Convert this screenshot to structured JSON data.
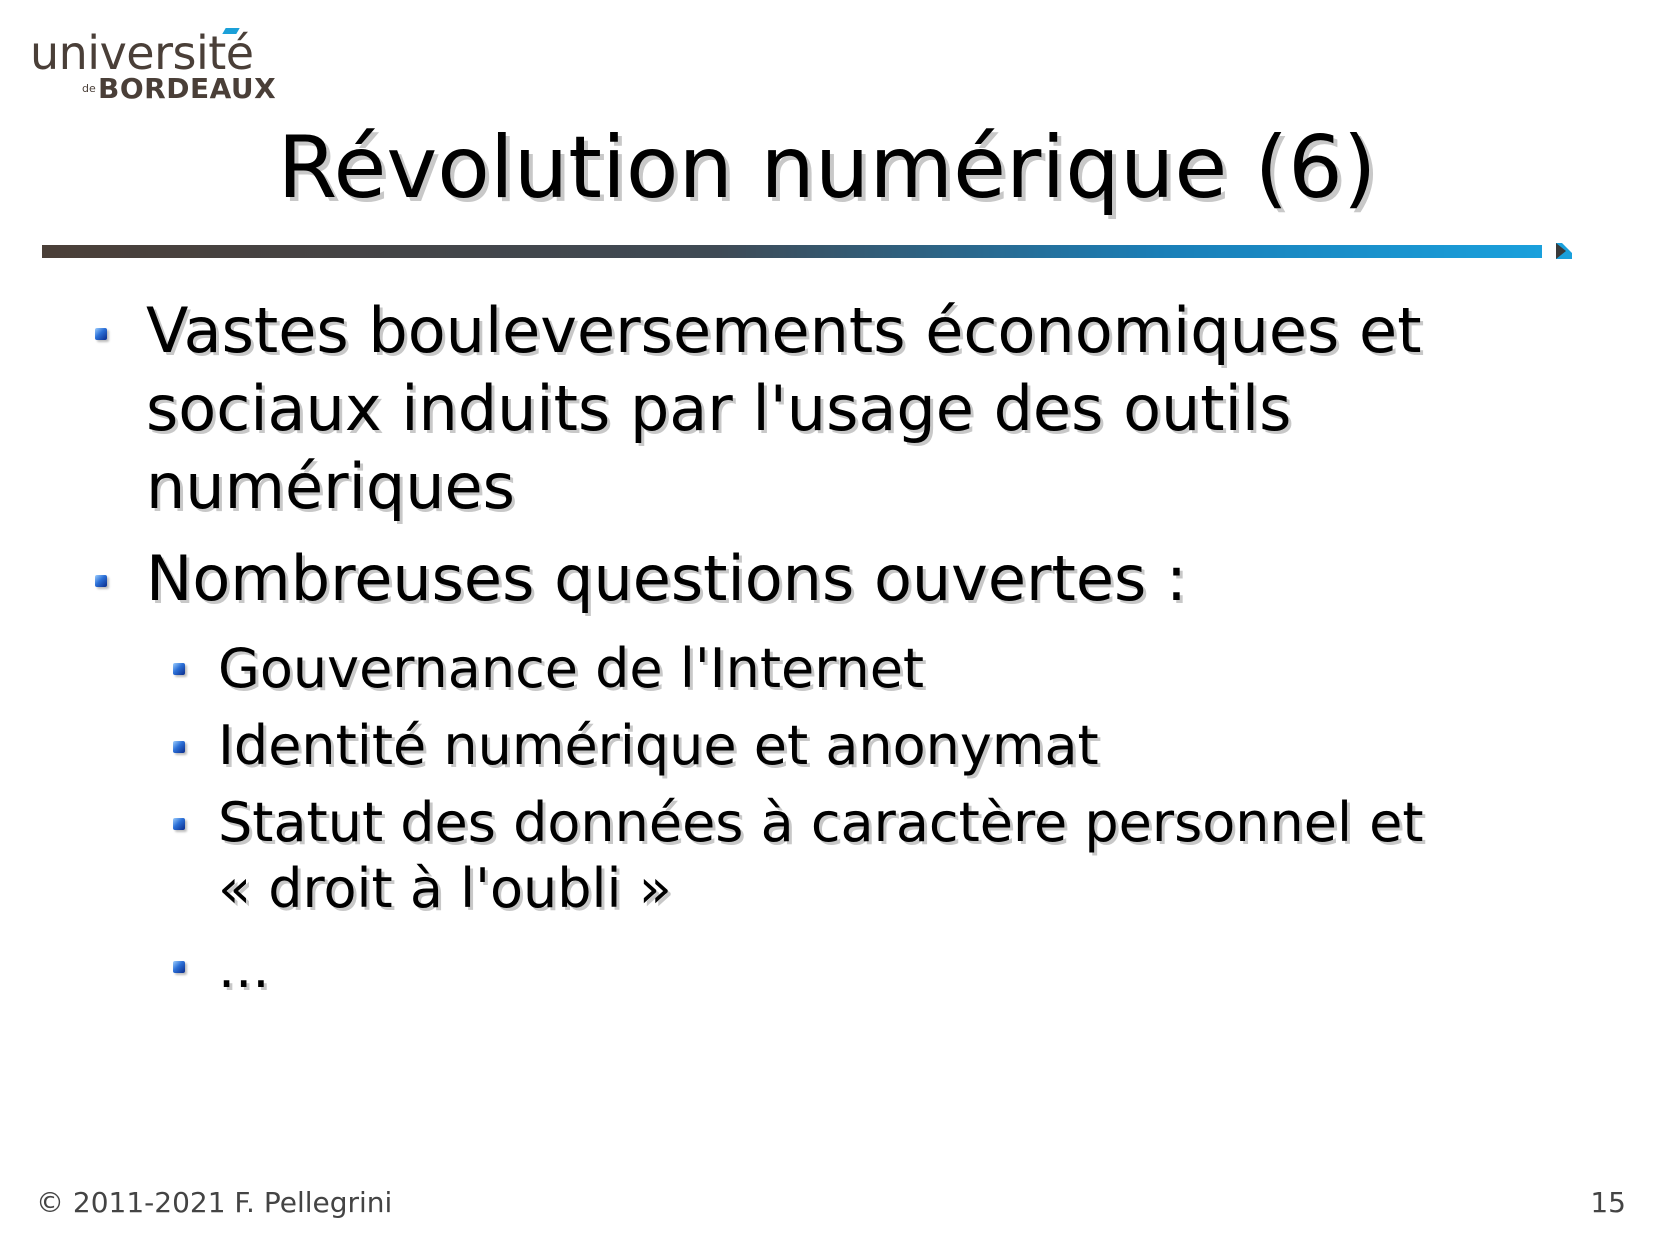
{
  "logo": {
    "word": "université",
    "de": "de",
    "name": "BORDEAUX"
  },
  "slide": {
    "title": "Révolution numérique (6)",
    "bullets": [
      {
        "lines": [
          "Vastes bouleversements économiques et",
          "sociaux induits par l'usage des outils",
          "numériques"
        ]
      },
      {
        "lines": [
          "Nombreuses questions ouvertes :"
        ],
        "sub": [
          {
            "lines": [
              "Gouvernance de l'Internet"
            ]
          },
          {
            "lines": [
              "Identité numérique et anonymat"
            ]
          },
          {
            "lines": [
              "Statut des données à caractère personnel et",
              "« droit à l'oubli »"
            ]
          },
          {
            "lines": [
              "..."
            ]
          }
        ]
      }
    ]
  },
  "footer": {
    "copyright": "© 2011-2021 F. Pellegrini",
    "page_number": "15"
  },
  "colors": {
    "rule_dark": "#4a3f38",
    "rule_blue": "#1aa0dc",
    "bullet": "#2b6fd6"
  }
}
